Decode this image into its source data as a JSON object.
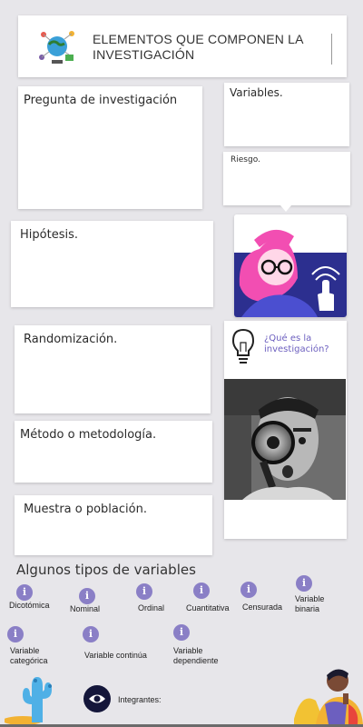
{
  "header": {
    "title": "ELEMENTOS QUE COMPONEN LA INVESTIGACIÓN"
  },
  "cards": {
    "pregunta": "Pregunta de investigación",
    "variables": "Variables.",
    "riesgo": "Riesgo.",
    "hipotesis": "Hipótesis.",
    "randomizacion": "Randomización.",
    "metodo": "Método o metodología.",
    "muestra": "Muestra o población."
  },
  "promo": {
    "question": "¿Qué es la investigación?"
  },
  "variables_section": {
    "title": "Algunos tipos de variables",
    "items": [
      "Dicotómica",
      "Nominal",
      "Ordinal",
      "Cuantitativa",
      "Censurada",
      "Variable binaria",
      "Variable categórica",
      "Variable continúa",
      "Variable dependiente"
    ]
  },
  "footer": {
    "integrantes": "Integrantes:"
  },
  "colors": {
    "accent": "#8a7fc6",
    "pink": "#f24eb2",
    "navy": "#2c2f8f",
    "background": "#e7e6ea"
  },
  "icons": [
    "globe-network-icon",
    "lightbulb-icon",
    "info-icon",
    "eye-icon",
    "cactus-icon",
    "person-illustration-icon"
  ]
}
